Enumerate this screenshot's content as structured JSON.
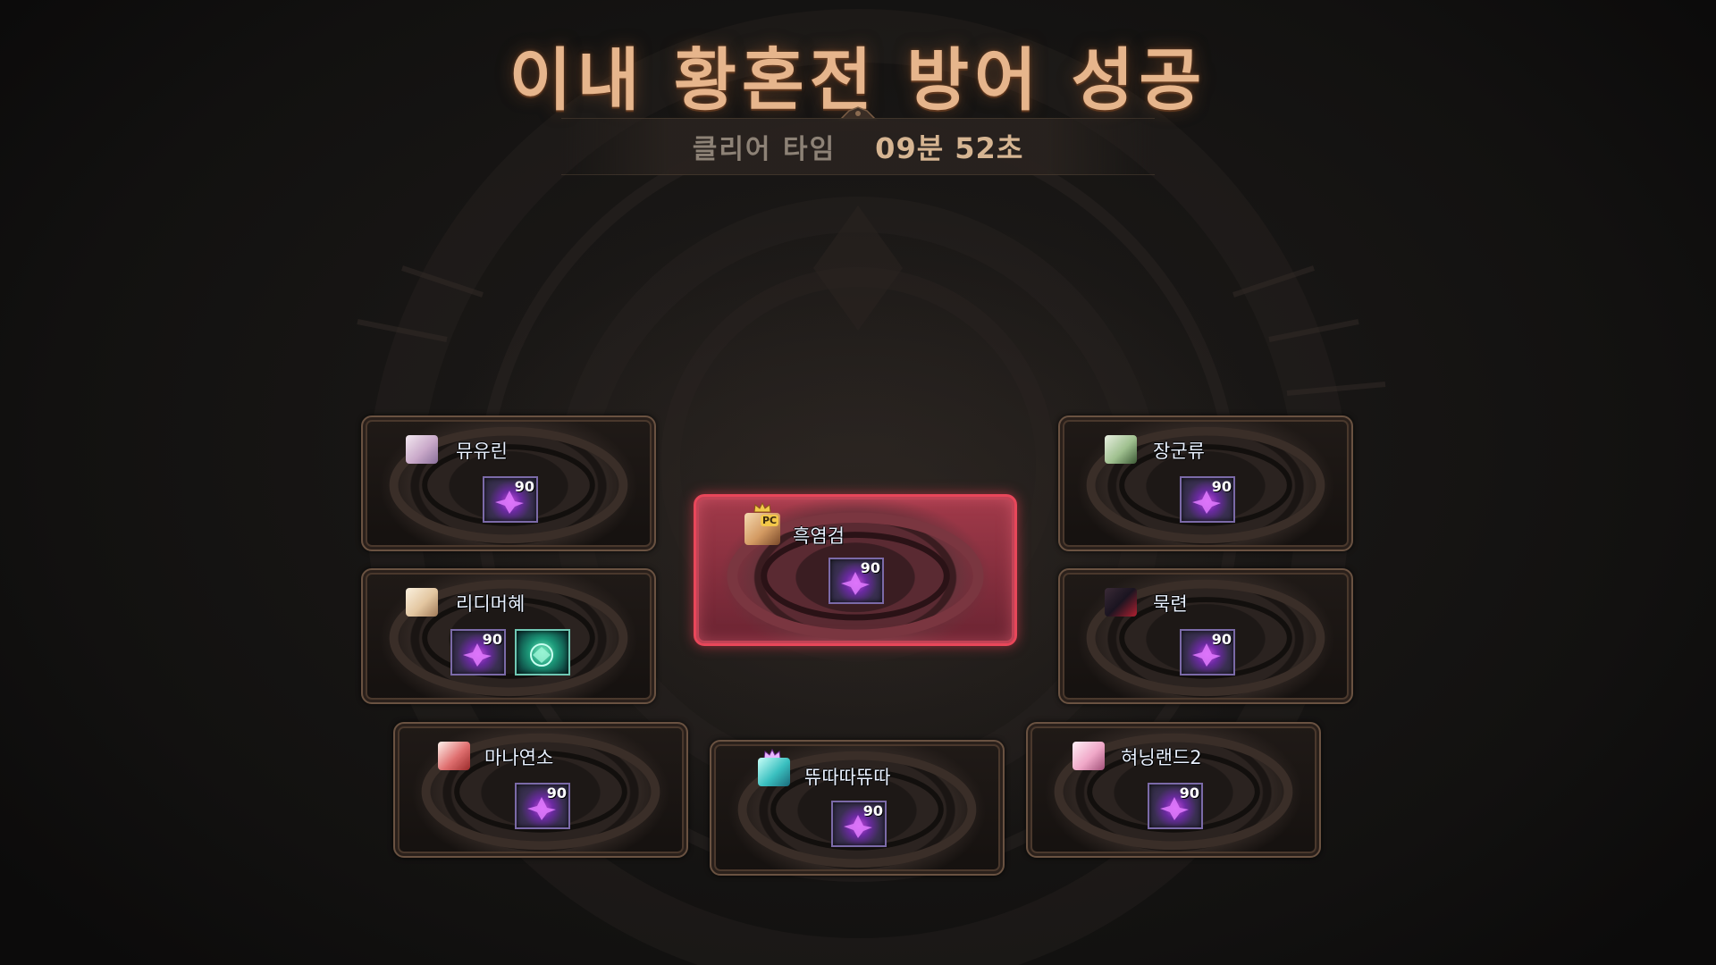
{
  "screen": {
    "title": "이내 황혼전 방어 성공",
    "clear_label": "클리어 타임",
    "clear_time": "09분 52초"
  },
  "colors": {
    "title": "#e6b58c",
    "highlight_border": "#e8475a",
    "card_border": "#6a5241",
    "name_text": "#e9f1ff"
  },
  "players": [
    {
      "name": "뮤유린",
      "item_level": "90",
      "avatar": "white-hair-girl-avatar"
    },
    {
      "name": "장군류",
      "item_level": "90",
      "avatar": "green-hair-avatar"
    },
    {
      "name": "흑염검",
      "item_level": "90",
      "avatar": "crowned-fighter-avatar",
      "badge": "PC",
      "highlighted": true
    },
    {
      "name": "리디머혜",
      "item_level": "90",
      "avatar": "blonde-girl-avatar",
      "extra_item": "green-emblem-icon"
    },
    {
      "name": "묵련",
      "item_level": "90",
      "avatar": "dark-hair-avatar"
    },
    {
      "name": "마나연소",
      "item_level": "90",
      "avatar": "red-hood-avatar"
    },
    {
      "name": "뜌따따뜌따",
      "item_level": "90",
      "avatar": "teal-hair-crowned-avatar"
    },
    {
      "name": "혀닝랜드2",
      "item_level": "90",
      "avatar": "pink-bunny-avatar"
    }
  ]
}
